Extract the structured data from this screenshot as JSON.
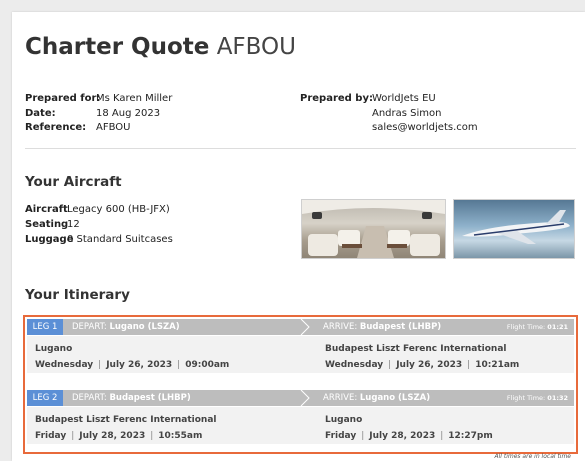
{
  "header": {
    "title_bold": "Charter Quote",
    "title_code": "AFBOU"
  },
  "prepared_for": [
    {
      "label": "Prepared for:",
      "value": "Ms Karen Miller"
    },
    {
      "label": "Date:",
      "value": "18 Aug 2023"
    },
    {
      "label": "Reference:",
      "value": "AFBOU"
    }
  ],
  "prepared_by": {
    "label": "Prepared by:",
    "lines": [
      "WorldJets EU",
      "Andras Simon",
      "sales@worldjets.com"
    ]
  },
  "aircraft": {
    "heading": "Your Aircraft",
    "rows": [
      {
        "label": "Aircraft",
        "value": "Legacy 600 (HB-JFX)"
      },
      {
        "label": "Seating",
        "value": "12"
      },
      {
        "label": "Luggage",
        "value": "0 Standard Suitcases"
      }
    ]
  },
  "itinerary": {
    "heading": "Your Itinerary",
    "legs": [
      {
        "badge": "LEG 1",
        "depart_label": "DEPART:",
        "depart_code": "Lugano (LSZA)",
        "arrive_label": "ARRIVE:",
        "arrive_code": "Budapest (LHBP)",
        "flight_time_label": "Flight Time:",
        "flight_time": "01:21",
        "from_name": "Lugano",
        "from_day": "Wednesday",
        "from_date": "July 26, 2023",
        "from_time": "09:00am",
        "to_name": "Budapest Liszt Ferenc International",
        "to_day": "Wednesday",
        "to_date": "July 26, 2023",
        "to_time": "10:21am"
      },
      {
        "badge": "LEG 2",
        "depart_label": "DEPART:",
        "depart_code": "Budapest (LHBP)",
        "arrive_label": "ARRIVE:",
        "arrive_code": "Lugano (LSZA)",
        "flight_time_label": "Flight Time:",
        "flight_time": "01:32",
        "from_name": "Budapest Liszt Ferenc International",
        "from_day": "Friday",
        "from_date": "July 28, 2023",
        "from_time": "10:55am",
        "to_name": "Lugano",
        "to_day": "Friday",
        "to_date": "July 28, 2023",
        "to_time": "12:27pm"
      }
    ],
    "separator": "|",
    "footnote": "All times are in local time"
  }
}
